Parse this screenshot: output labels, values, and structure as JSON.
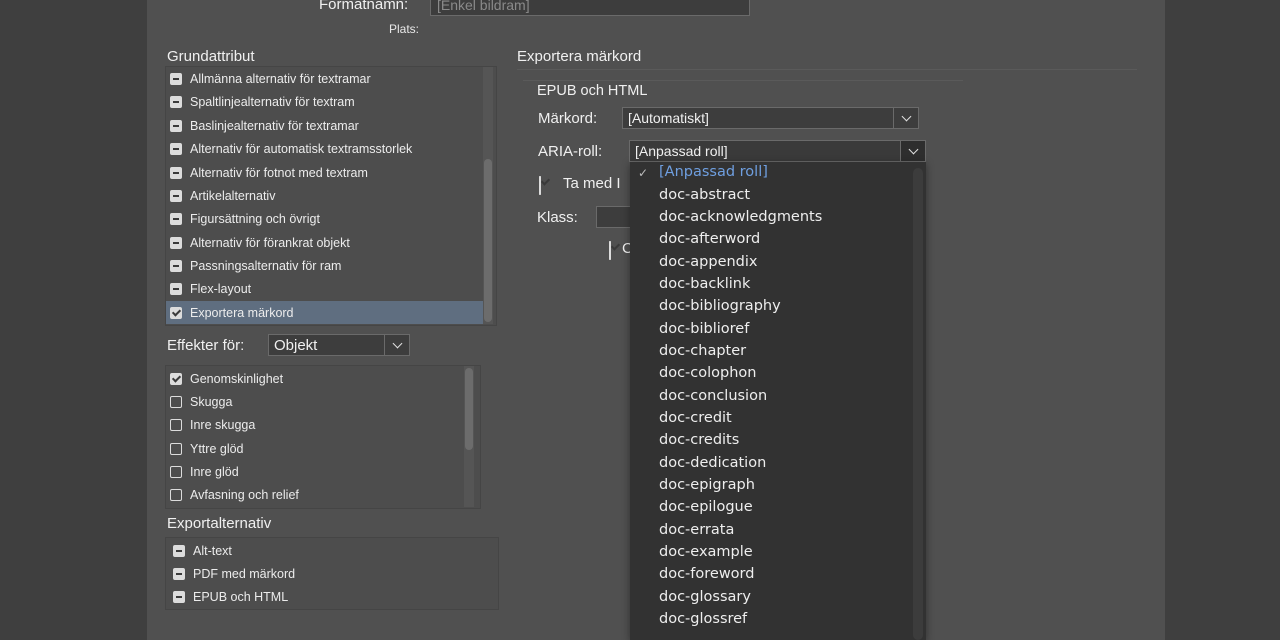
{
  "header": {
    "format_name_label": "Formatnamn:",
    "format_name_value": "[Enkel bildram]",
    "location_label": "Plats:"
  },
  "basic_attributes": {
    "title": "Grundattribut",
    "items": [
      {
        "label": "Allmänna alternativ för textramar",
        "state": "mixed"
      },
      {
        "label": "Spaltlinjealternativ för textram",
        "state": "mixed"
      },
      {
        "label": "Baslinjealternativ för textramar",
        "state": "mixed"
      },
      {
        "label": "Alternativ för automatisk textramsstorlek",
        "state": "mixed"
      },
      {
        "label": "Alternativ för fotnot med textram",
        "state": "mixed"
      },
      {
        "label": "Artikelalternativ",
        "state": "mixed"
      },
      {
        "label": "Figursättning och övrigt",
        "state": "mixed"
      },
      {
        "label": "Alternativ för förankrat objekt",
        "state": "mixed"
      },
      {
        "label": "Passningsalternativ för ram",
        "state": "mixed"
      },
      {
        "label": "Flex-layout",
        "state": "mixed"
      },
      {
        "label": "Exportera märkord",
        "state": "checked",
        "selected": true
      }
    ]
  },
  "effects": {
    "label": "Effekter för:",
    "selected": "Objekt",
    "items": [
      {
        "label": "Genomskinlighet",
        "state": "checked"
      },
      {
        "label": "Skugga",
        "state": "unchecked"
      },
      {
        "label": "Inre skugga",
        "state": "unchecked"
      },
      {
        "label": "Yttre glöd",
        "state": "unchecked"
      },
      {
        "label": "Inre glöd",
        "state": "unchecked"
      },
      {
        "label": "Avfasning och relief",
        "state": "unchecked"
      }
    ]
  },
  "export_options": {
    "title": "Exportalternativ",
    "items": [
      {
        "label": "Alt-text",
        "state": "mixed"
      },
      {
        "label": "PDF med märkord",
        "state": "mixed"
      },
      {
        "label": "EPUB och HTML",
        "state": "mixed"
      }
    ]
  },
  "export_tags": {
    "title": "Exportera märkord",
    "section_title": "EPUB och HTML",
    "tag_label": "Märkord:",
    "tag_value": "[Automatiskt]",
    "aria_label": "ARIA-roll:",
    "aria_value": "[Anpassad roll]",
    "include_label_partial": "Ta med I",
    "include_checked": true,
    "class_label": "Klass:",
    "second_checkbox_partial": "C",
    "second_checkbox_checked": true
  },
  "aria_menu": {
    "selected_index": 0,
    "options": [
      "[Anpassad roll]",
      "doc-abstract",
      "doc-acknowledgments",
      "doc-afterword",
      "doc-appendix",
      "doc-backlink",
      "doc-bibliography",
      "doc-biblioref",
      "doc-chapter",
      "doc-colophon",
      "doc-conclusion",
      "doc-credit",
      "doc-credits",
      "doc-dedication",
      "doc-epigraph",
      "doc-epilogue",
      "doc-errata",
      "doc-example",
      "doc-foreword",
      "doc-glossary",
      "doc-glossref"
    ]
  }
}
